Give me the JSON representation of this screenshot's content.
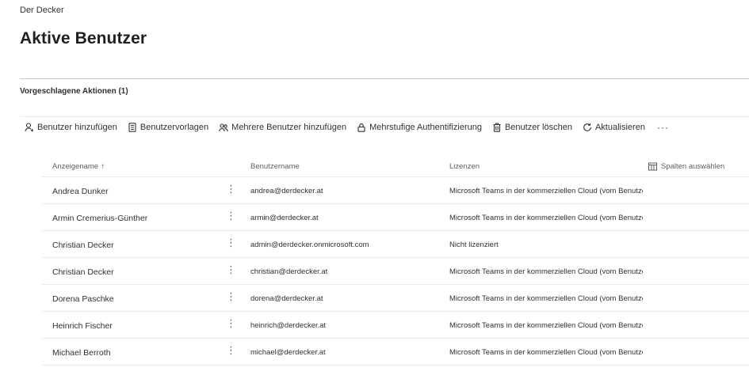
{
  "header": {
    "org_name": "Der Decker",
    "page_title": "Aktive Benutzer"
  },
  "suggestions": {
    "label": "Vorgeschlagene Aktionen (1)"
  },
  "toolbar": {
    "add_user": "Benutzer hinzufügen",
    "user_templates": "Benutzervorlagen",
    "add_multiple": "Mehrere Benutzer hinzufügen",
    "mfa": "Mehrstufige Authentifizierung",
    "delete_user": "Benutzer löschen",
    "refresh": "Aktualisieren",
    "more": "···"
  },
  "table": {
    "columns": {
      "display_name": "Anzeigename",
      "sort_indicator": "↑",
      "username": "Benutzername",
      "licenses": "Lizenzen",
      "choose_columns": "Spalten auswählen"
    },
    "rows": [
      {
        "name": "Andrea Dunker",
        "upn": "andrea@derdecker.at",
        "license": "Microsoft Teams in der kommerziellen Cloud (vom Benutze"
      },
      {
        "name": "Armin Cremerius-Günther",
        "upn": "armin@derdecker.at",
        "license": "Microsoft Teams in der kommerziellen Cloud (vom Benutze"
      },
      {
        "name": "Christian Decker",
        "upn": "admin@derdecker.onmicrosoft.com",
        "license": "Nicht lizenziert"
      },
      {
        "name": "Christian Decker",
        "upn": "christian@derdecker.at",
        "license": "Microsoft Teams in der kommerziellen Cloud (vom Benutze"
      },
      {
        "name": "Dorena Paschke",
        "upn": "dorena@derdecker.at",
        "license": "Microsoft Teams in der kommerziellen Cloud (vom Benutze"
      },
      {
        "name": "Heinrich Fischer",
        "upn": "heinrich@derdecker.at",
        "license": "Microsoft Teams in der kommerziellen Cloud (vom Benutze"
      },
      {
        "name": "Michael Berroth",
        "upn": "michael@derdecker.at",
        "license": "Microsoft Teams in der kommerziellen Cloud (vom Benutze"
      }
    ],
    "row_menu_glyph": "⋮"
  }
}
